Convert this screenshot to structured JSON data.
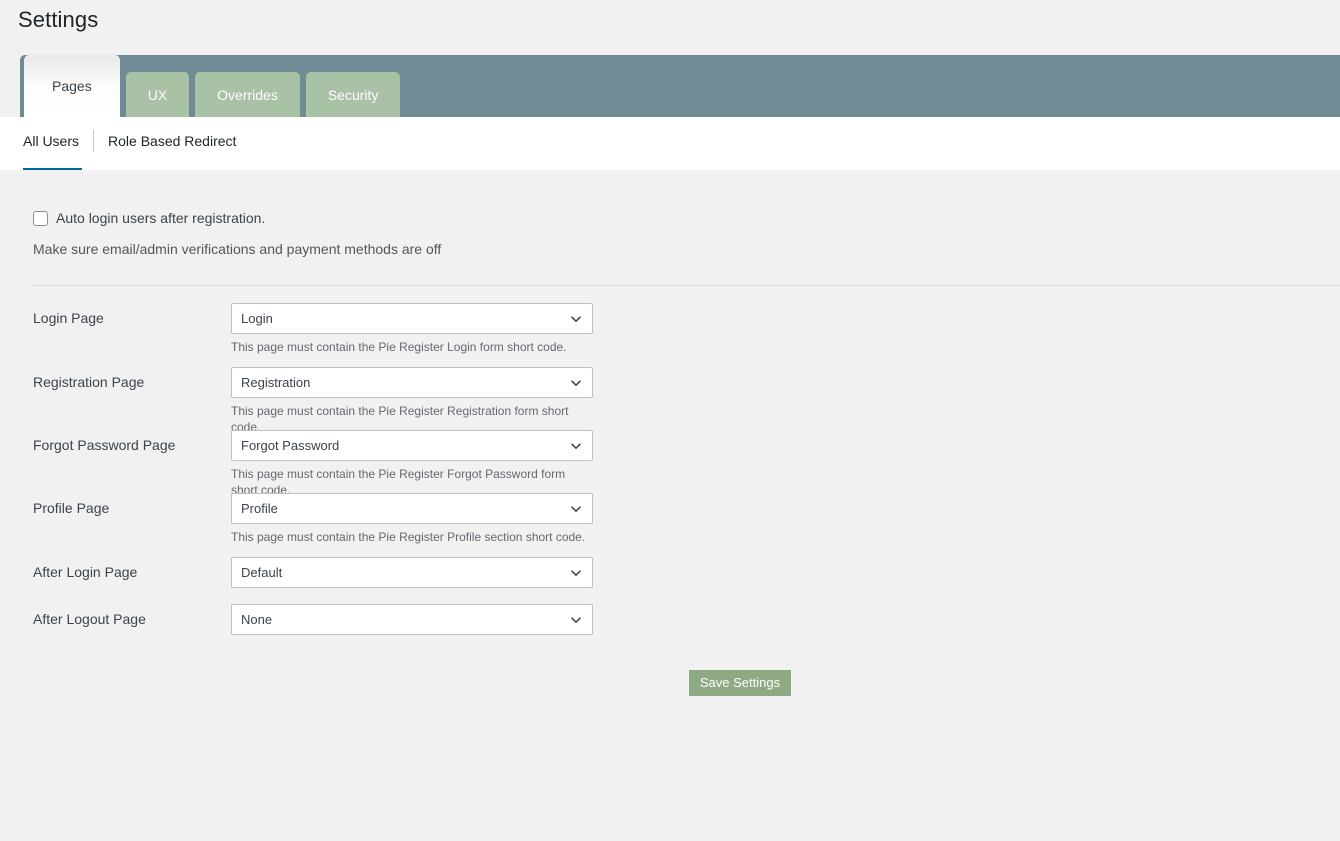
{
  "page": {
    "title": "Settings"
  },
  "tabs": [
    {
      "label": "Pages",
      "active": true
    },
    {
      "label": "UX",
      "active": false
    },
    {
      "label": "Overrides",
      "active": false
    },
    {
      "label": "Security",
      "active": false
    }
  ],
  "subnav": [
    {
      "label": "All Users",
      "active": true
    },
    {
      "label": "Role Based Redirect",
      "active": false
    }
  ],
  "autologin": {
    "checkbox_label": "Auto login users after registration.",
    "checked": false,
    "hint": "Make sure email/admin verifications and payment methods are off"
  },
  "fields": [
    {
      "label": "Login Page",
      "value": "Login",
      "hint": "This page must contain the Pie Register Login form short code."
    },
    {
      "label": "Registration Page",
      "value": "Registration",
      "hint": "This page must contain the Pie Register Registration form short code."
    },
    {
      "label": "Forgot Password Page",
      "value": "Forgot Password",
      "hint": "This page must contain the Pie Register Forgot Password form short code."
    },
    {
      "label": "Profile Page",
      "value": "Profile",
      "hint": "This page must contain the Pie Register Profile section short code."
    },
    {
      "label": "After Login Page",
      "value": "Default",
      "hint": ""
    },
    {
      "label": "After Logout Page",
      "value": "None",
      "hint": ""
    }
  ],
  "actions": {
    "save_label": "Save Settings"
  },
  "icons": {
    "chevron_down": "chevron-down-icon",
    "checkbox": "checkbox-icon"
  },
  "colors": {
    "tabbar_teal": "#6f8b95",
    "tab_green": "#a9c1a4",
    "save_green": "#8faa83",
    "subnav_underline_blue": "#00669b",
    "page_background": "#f1f1f1"
  }
}
